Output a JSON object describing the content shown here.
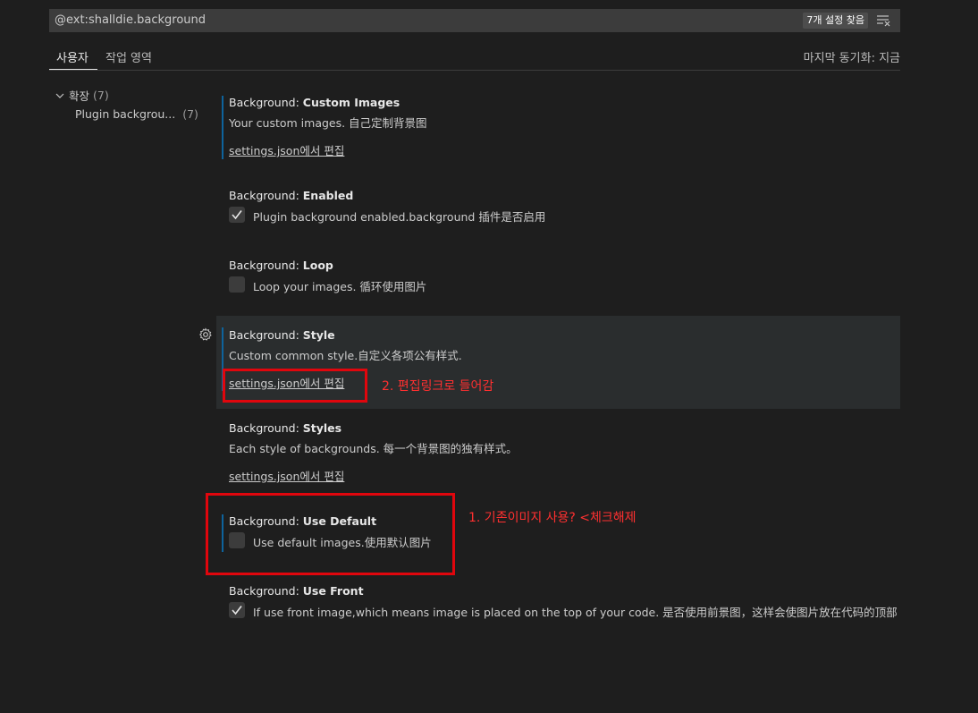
{
  "search": {
    "query": "@ext:shalldie.background",
    "result_badge": "7개 설정 찾음",
    "filter_icon": "clear-filter-icon"
  },
  "tabs": {
    "user": "사용자",
    "workspace": "작업 영역",
    "last_sync": "마지막 동기화: 지금"
  },
  "toc": {
    "extensions_label": "확장",
    "extensions_count": "(7)",
    "plugin_label": "Plugin backgrou...",
    "plugin_count": "(7)"
  },
  "settings": [
    {
      "category": "Background: ",
      "name": "Custom Images",
      "description": "Your custom images. 自己定制背景图",
      "link": "settings.json에서 편집"
    },
    {
      "category": "Background: ",
      "name": "Enabled",
      "description": "Plugin background enabled.background 插件是否启用",
      "checked": true
    },
    {
      "category": "Background: ",
      "name": "Loop",
      "description": "Loop your images. 循环使用图片",
      "checked": false
    },
    {
      "category": "Background: ",
      "name": "Style",
      "description": "Custom common style.自定义各项公有样式.",
      "link": "settings.json에서 편집"
    },
    {
      "category": "Background: ",
      "name": "Styles",
      "description": "Each style of backgrounds. 每一个背景图的独有样式。",
      "link": "settings.json에서 편집"
    },
    {
      "category": "Background: ",
      "name": "Use Default",
      "description": "Use default images.使用默认图片",
      "checked": false
    },
    {
      "category": "Background: ",
      "name": "Use Front",
      "description": "If use front image,which means image is placed on the top of your code. 是否使用前景图，这样会使图片放在代码的顶部",
      "checked": true
    }
  ],
  "annotations": {
    "step1": "1. 기존이미지 사용? <체크해제",
    "step2": "2. 편집링크로 들어감",
    "color": "#e0060d"
  }
}
